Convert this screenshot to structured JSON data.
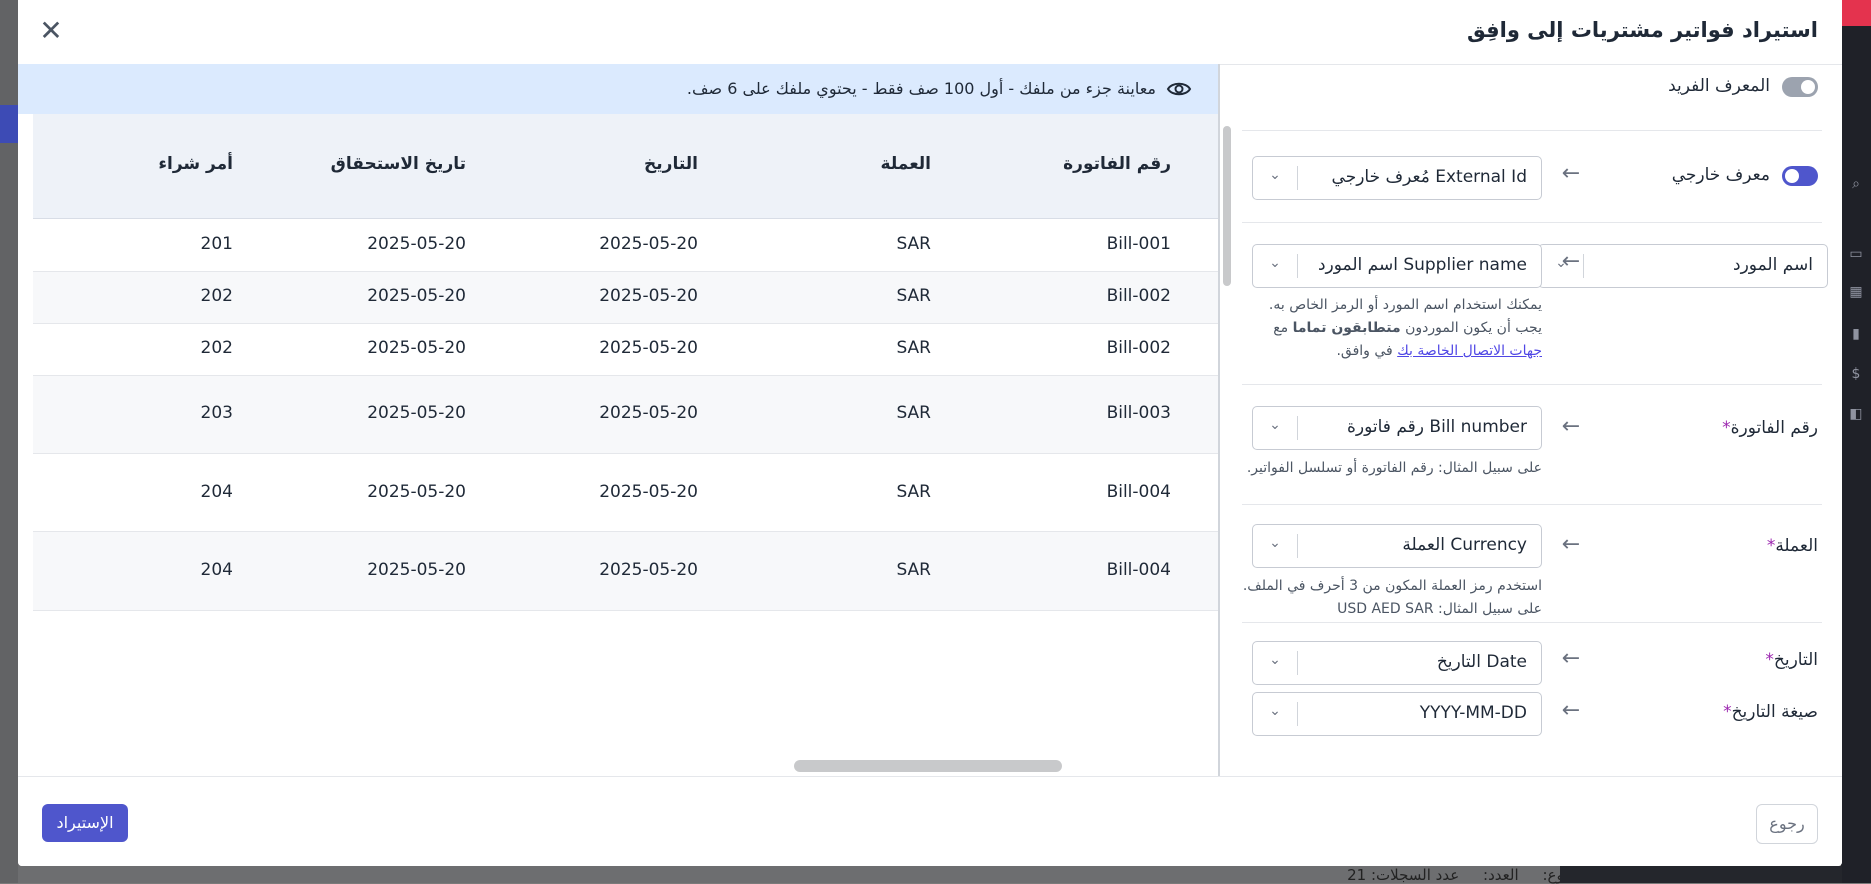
{
  "modal": {
    "title": "استيراد فواتير مشتريات إلى وافِق",
    "close_icon": "close-icon"
  },
  "preview": {
    "notice": "معاينة جزء من ملفك - أول 100 صف فقط - يحتوي ملفك على 6 صف.",
    "notice_icon": "eye-icon",
    "columns": [
      "رقم الفاتورة",
      "العملة",
      "التاريخ",
      "تاريخ الاستحقاق",
      "أمر شراء"
    ],
    "rows": [
      [
        "Bill-001",
        "SAR",
        "2025-05-20",
        "2025-05-20",
        "201"
      ],
      [
        "Bill-002",
        "SAR",
        "2025-05-20",
        "2025-05-20",
        "202"
      ],
      [
        "Bill-002",
        "SAR",
        "2025-05-20",
        "2025-05-20",
        "202"
      ],
      [
        "Bill-003",
        "SAR",
        "2025-05-20",
        "2025-05-20",
        "203"
      ],
      [
        "Bill-004",
        "SAR",
        "2025-05-20",
        "2025-05-20",
        "204"
      ],
      [
        "Bill-004",
        "SAR",
        "2025-05-20",
        "2025-05-20",
        "204"
      ]
    ]
  },
  "mapping": {
    "unique_id": {
      "label": "المعرف الفريد",
      "enabled": false
    },
    "external_id": {
      "label": "معرف خارجي",
      "enabled": true,
      "value": "External Id مُعرف خارجي"
    },
    "supplier": {
      "source": "اسم المورد",
      "value": "Supplier name اسم المورد",
      "help_1": "يمكنك استخدام اسم المورد أو الرمز الخاص به. يجب أن يكون الموردون",
      "help_bold": "متطابقون تماما",
      "help_2": "مع",
      "help_link": "جهات الاتصال الخاصة بك",
      "help_3": "في وافق."
    },
    "bill_number": {
      "label": "رقم الفاتورة",
      "required": "*",
      "value": "Bill number رقم فاتورة",
      "help": "على سبيل المثال: رقم الفاتورة أو تسلسل الفواتير."
    },
    "currency": {
      "label": "العملة",
      "required": "*",
      "value": "Currency العملة",
      "help": "استخدم رمز العملة المكون من 3 أحرف في الملف. على سبيل المثال: USD AED SAR"
    },
    "date": {
      "label": "التاريخ",
      "required": "*",
      "value": "Date التاريخ"
    },
    "date_format": {
      "label": "صيغة التاريخ",
      "required": "*",
      "value": "YYYY-MM-DD"
    },
    "arrow_icon": "arrow-left-icon",
    "chevron_icon": "chevron-down-icon"
  },
  "footer": {
    "import_label": "الإستيراد",
    "back_label": "رجوع"
  },
  "background": {
    "total_label": "المجموع:",
    "count_label": "العدد:",
    "records_label": "عدد السجلات: 21"
  },
  "colors": {
    "accent": "#4f56cc",
    "info_bar": "#dbeafe",
    "toggle_on": "#4f56cc",
    "toggle_off": "#9ca3af",
    "required": "#9c27b0"
  }
}
